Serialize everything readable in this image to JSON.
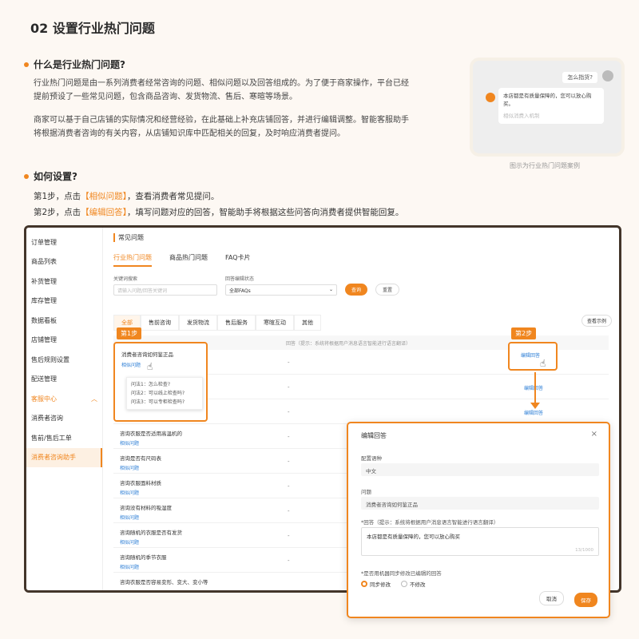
{
  "page": {
    "title": "02 设置行业热门问题",
    "section1": "什么是行业热门问题?",
    "para1": "行业热门问题是由一系列消费者经常咨询的问题、相似问题以及回答组成的。为了便于商家操作，平台已经提前预设了一些常见问题，包含商品咨询、发货物流、售后、寒暄等场景。",
    "para2": "商家可以基于自己店铺的实际情况和经营经验，在此基础上补充店铺回答，并进行编辑调整。智能客服助手将根据消费者咨询的有关内容，从店铺知识库中匹配相关的回复，及时响应消费者提问。",
    "section2": "如何设置?",
    "step1_prefix": "第1步，点击",
    "step1_hl": "【相似问题】",
    "step1_suffix": "，查看消费者常见提问。",
    "step2_prefix": "第2步，点击",
    "step2_hl": "【编辑回答】",
    "step2_suffix": "，填写问题对应的回答，智能助手将根据这些问答向消费者提供智能回复。"
  },
  "example": {
    "question": "怎么指货?",
    "answer": "本店都是有质量保障的，您可以放心购买。",
    "link": "相似消费入机制",
    "caption": "图示为行业热门问题案例"
  },
  "sidebar": {
    "items": [
      "订单管理",
      "商品列表",
      "补货管理",
      "库存管理",
      "数据看板",
      "店铺管理",
      "售后规则设置",
      "配送管理"
    ],
    "group": "客服中心",
    "subitems": [
      "消费者咨询",
      "售前/售后工单"
    ],
    "active": "消费者咨询助手"
  },
  "main": {
    "title": "常见问题",
    "tabs": [
      "行业热门问题",
      "商品热门问题",
      "FAQ卡片"
    ],
    "filter_keyword_label": "关键词搜索",
    "filter_keyword_placeholder": "请输入问题/回答关键词",
    "filter_status_label": "回答编辑状态",
    "filter_status_value": "全部FAQs",
    "search_btn": "查询",
    "reset_btn": "重置",
    "categories": [
      "全部",
      "售前咨询",
      "发货物流",
      "售后服务",
      "寒暄互动",
      "其他"
    ],
    "view_example": "查看示例",
    "header_answer": "回答（提示：系统将根据用户消息语言智能进行语言翻译）",
    "rows": [
      {
        "q": "",
        "a": "-",
        "op": ""
      },
      {
        "q": "",
        "a": "-",
        "op": "编辑回答"
      },
      {
        "q": "",
        "a": "-",
        "op": "编辑回答"
      },
      {
        "q": "咨询衣服是否适用高温机的",
        "a": "-",
        "op": ""
      },
      {
        "q": "咨询是否有尺码表",
        "a": "-",
        "op": ""
      },
      {
        "q": "咨询衣服面料材质",
        "a": "-",
        "op": ""
      },
      {
        "q": "咨询没有材料的吸湿度",
        "a": "-",
        "op": ""
      },
      {
        "q": "咨询随机的衣服是否有发货",
        "a": "-",
        "op": ""
      },
      {
        "q": "咨询随机的季节衣服",
        "a": "-",
        "op": ""
      },
      {
        "q": "咨询衣服是否容易变形、变大、变小等",
        "a": "-",
        "op": ""
      }
    ],
    "similar_link": "相似问题"
  },
  "step1": {
    "badge": "第1步",
    "question": "消费者咨询如何鉴正品",
    "link": "相似问题",
    "popover": [
      "问法1：怎么检查?",
      "问法2：可以线上检查吗?",
      "问法3：可以专柜检查吗?"
    ]
  },
  "step2": {
    "badge": "第2步",
    "link": "编辑回答"
  },
  "dialog": {
    "title": "编辑回答",
    "close": "×",
    "lang_label": "配置语种",
    "lang_value": "中文",
    "question_label": "问题",
    "question_value": "消费者咨询如何鉴正品",
    "answer_label": "*回答（提示：系统将根据用户消息语言智能进行语言翻译）",
    "answer_value": "本店都是有质量保障的，您可以放心购买",
    "count": "13/1000",
    "sync_label": "*是否用机器同步修改已编辑的回答",
    "radio1": "同步修改",
    "radio2": "不修改",
    "cancel": "取消",
    "ok": "保存"
  },
  "colors": {
    "accent": "#f0861f",
    "frame": "#43352a"
  }
}
